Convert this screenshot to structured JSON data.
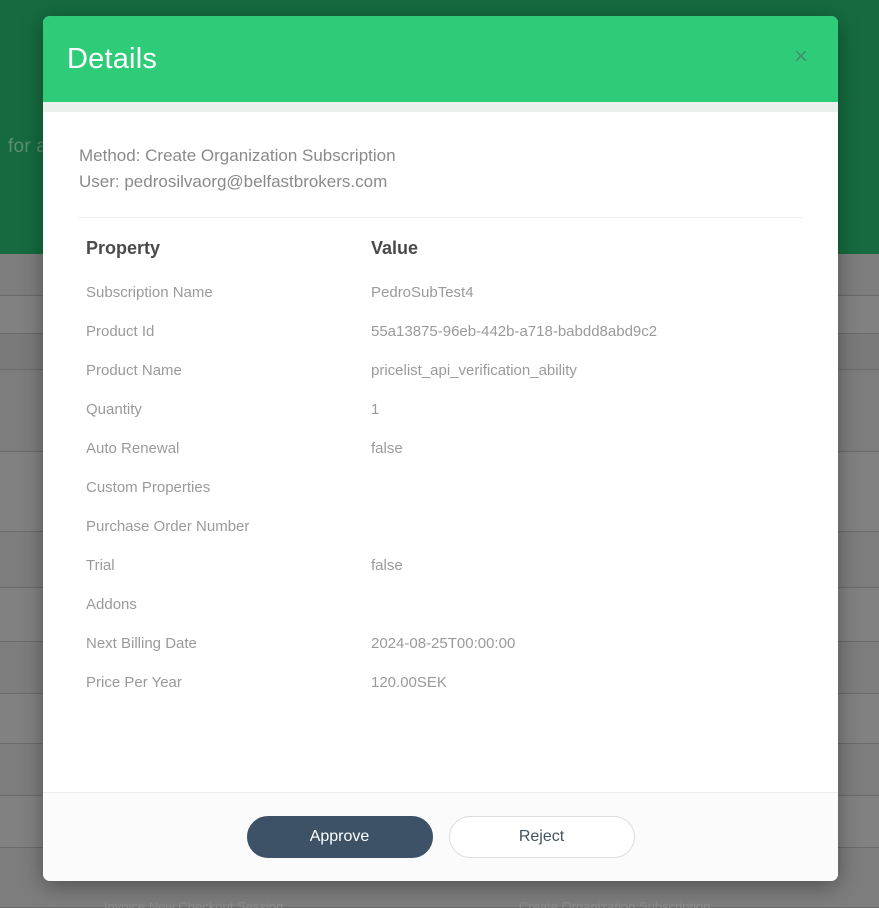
{
  "background": {
    "banner_text": "for a",
    "bottom_labels": {
      "left": "Invoice New Checkout Session",
      "right": "Create Organization Subscription"
    },
    "banner_color": "#156b3f",
    "overlay_color": "#7d7d7d"
  },
  "modal": {
    "title": "Details",
    "close_label": "×",
    "accent_color": "#2ecc78",
    "meta": {
      "method": "Method: Create Organization Subscription",
      "user": "User: pedrosilvaorg@belfastbrokers.com"
    },
    "table": {
      "headers": {
        "property": "Property",
        "value": "Value"
      },
      "rows": [
        {
          "property": "Subscription Name",
          "value": "PedroSubTest4"
        },
        {
          "property": "Product Id",
          "value": "55a13875-96eb-442b-a718-babdd8abd9c2"
        },
        {
          "property": "Product Name",
          "value": "pricelist_api_verification_ability"
        },
        {
          "property": "Quantity",
          "value": "1"
        },
        {
          "property": "Auto Renewal",
          "value": "false"
        },
        {
          "property": "Custom Properties",
          "value": ""
        },
        {
          "property": "Purchase Order Number",
          "value": ""
        },
        {
          "property": "Trial",
          "value": "false"
        },
        {
          "property": "Addons",
          "value": ""
        },
        {
          "property": "Next Billing Date",
          "value": "2024-08-25T00:00:00"
        },
        {
          "property": "Price Per Year",
          "value": "120.00SEK"
        }
      ]
    },
    "footer": {
      "approve_label": "Approve",
      "reject_label": "Reject",
      "approve_color": "#3d5266"
    }
  }
}
